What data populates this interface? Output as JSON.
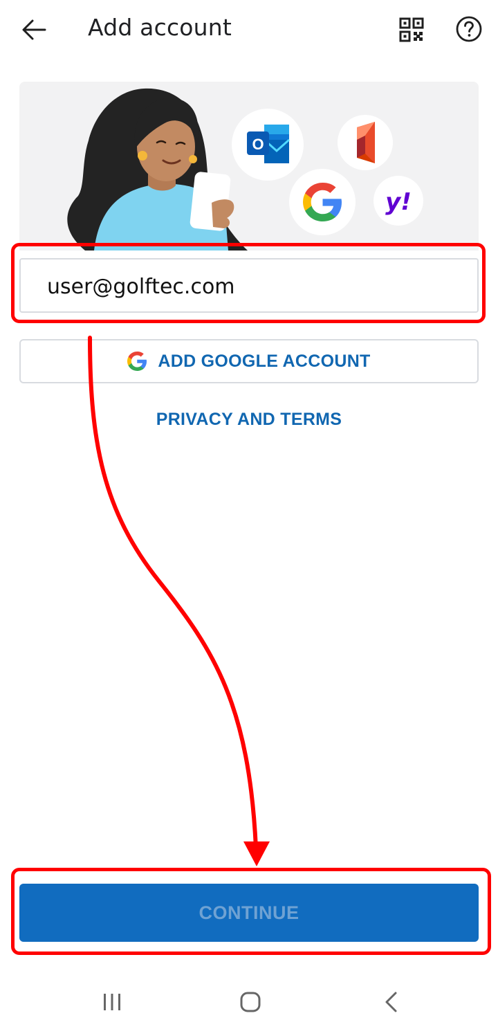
{
  "header": {
    "title": "Add account",
    "back_icon": "arrow-left-icon",
    "qr_icon": "qr-code-icon",
    "help_icon": "help-circle-icon"
  },
  "hero": {
    "services": [
      "outlook-icon",
      "office-icon",
      "google-icon",
      "yahoo-icon"
    ],
    "yahoo_text": "y!",
    "outlook_letter": "O"
  },
  "email": {
    "value": "user@golftec.com"
  },
  "google_button": {
    "label": "ADD GOOGLE ACCOUNT"
  },
  "privacy_link": {
    "label": "PRIVACY AND TERMS"
  },
  "continue_button": {
    "label": "CONTINUE",
    "state": "disabled"
  },
  "colors": {
    "accent": "#116cbf",
    "link": "#1167b1",
    "annotation": "#ff0000"
  }
}
